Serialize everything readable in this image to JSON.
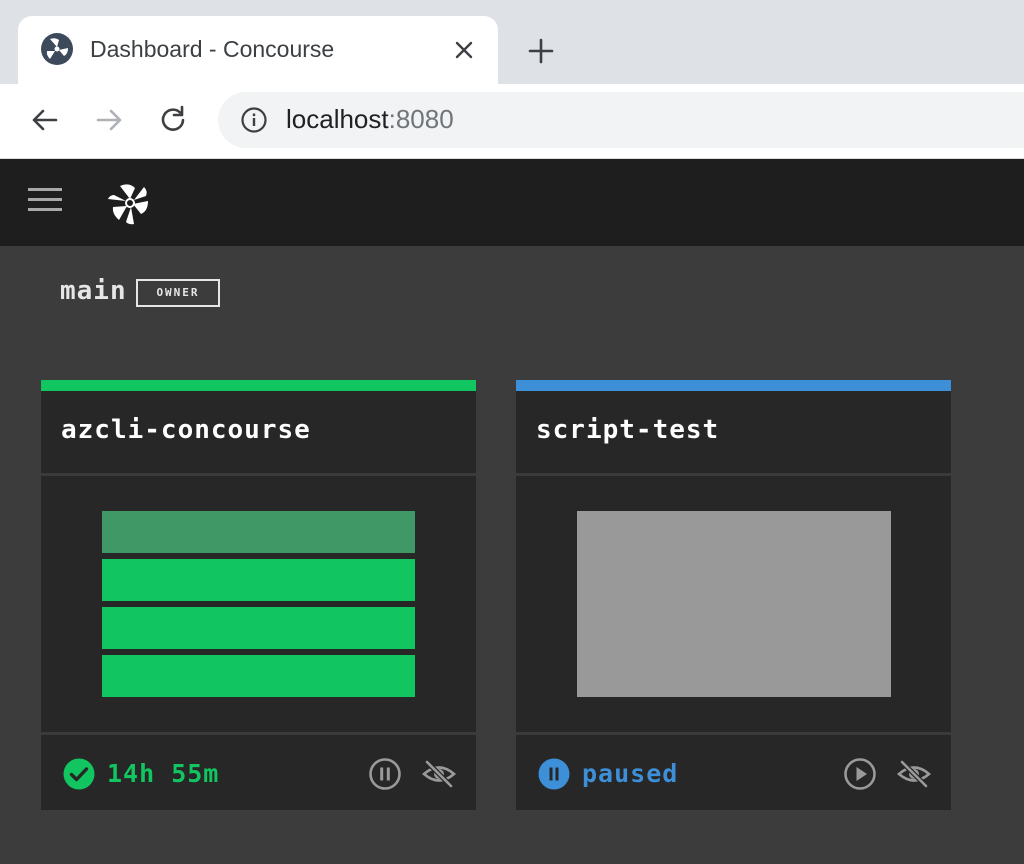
{
  "browser": {
    "tab_title": "Dashboard - Concourse",
    "url_host": "localhost",
    "url_port": ":8080"
  },
  "dashboard": {
    "team": {
      "name": "main",
      "role": "OWNER"
    },
    "pipelines": [
      {
        "name": "azcli-concourse",
        "status": "succeeded",
        "status_text": "14h 55m",
        "status_color": "#11c560",
        "jobs": [
          {
            "state": "succeeded-running",
            "color": "#419867"
          },
          {
            "state": "succeeded",
            "color": "#11c560"
          },
          {
            "state": "succeeded",
            "color": "#11c560"
          },
          {
            "state": "succeeded",
            "color": "#11c560"
          }
        ],
        "action_icon": "pause-circle-icon",
        "visibility_icon": "eye-hidden-icon"
      },
      {
        "name": "script-test",
        "status": "paused",
        "status_text": "paused",
        "status_color": "#3d8fd7",
        "jobs": [
          {
            "state": "paused",
            "color": "#999999"
          }
        ],
        "action_icon": "play-circle-icon",
        "visibility_icon": "eye-hidden-icon"
      }
    ]
  },
  "colors": {
    "topbar": "#1e1e1e",
    "background": "#3c3c3c",
    "card": "#272727",
    "succeeded": "#11c560",
    "paused": "#3d8fd7"
  }
}
